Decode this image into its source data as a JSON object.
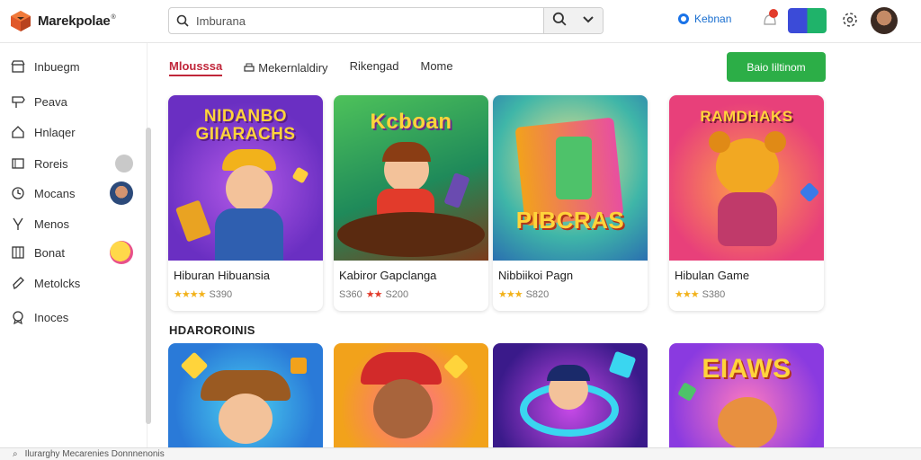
{
  "app": {
    "name": "Marekpolae",
    "mark": "®"
  },
  "search": {
    "value": "Imburana"
  },
  "account": {
    "label": "Kebnan"
  },
  "sidebar": {
    "items": [
      {
        "label": "Inbuegm",
        "icon": "store-icon"
      },
      {
        "label": "Peava",
        "icon": "sign-icon"
      },
      {
        "label": "Hnlaqer",
        "icon": "home-icon"
      },
      {
        "label": "Roreis",
        "icon": "film-icon"
      },
      {
        "label": "Mocans",
        "icon": "clock-icon"
      },
      {
        "label": "Menos",
        "icon": "branch-icon"
      },
      {
        "label": "Bonat",
        "icon": "book-icon"
      },
      {
        "label": "Metolcks",
        "icon": "pen-icon"
      },
      {
        "label": "Inoces",
        "icon": "badge-icon"
      }
    ]
  },
  "tabs": [
    {
      "label": "Mlousssa",
      "active": true
    },
    {
      "label": "Mekernlaldiry",
      "icon": "printer-icon"
    },
    {
      "label": "Rikengad"
    },
    {
      "label": "Mome"
    }
  ],
  "cta": {
    "label": "Baio Iiltinom"
  },
  "cards": [
    {
      "art_title": "NIDANBO GIIARACHS",
      "name": "Hiburan Hibuansia",
      "rating": "S390"
    },
    {
      "art_title": "Kcboan",
      "name": "Kabiror Gapclanga",
      "rating": "S200",
      "rating_prefix": "S360"
    },
    {
      "art_title": "PIBCRAS",
      "name": "Nibbiikoi Pagn",
      "rating": "S820"
    },
    {
      "art_title": "RAMDHAKS",
      "name": "Hibulan Game",
      "rating": "S380"
    }
  ],
  "section": {
    "title": "HDAROROINIS"
  },
  "cards2": [
    {
      "art_title": ""
    },
    {
      "art_title": ""
    },
    {
      "art_title": ""
    },
    {
      "art_title": "EIAWS"
    }
  ],
  "bottom": {
    "text": "Ilurarghy   Mecarenies   Donnnenonis"
  },
  "colors": {
    "accent": "#c0263a",
    "cta": "#2cae47",
    "link": "#1a6fd0"
  }
}
